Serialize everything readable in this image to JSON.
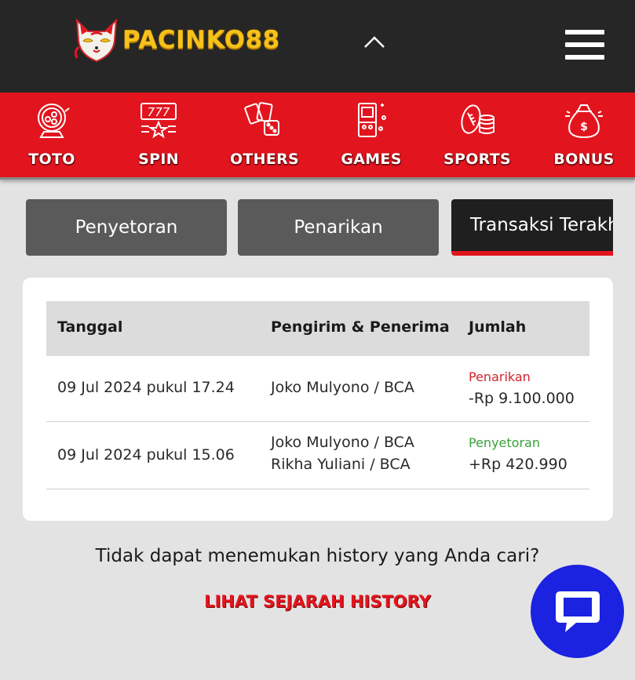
{
  "header": {
    "logo_text": "PACINKO88",
    "collapse_icon": "chevron-up-icon",
    "menu_icon": "hamburger-menu-icon"
  },
  "categories": [
    {
      "label": "TOTO",
      "icon": "lottery-drum-icon"
    },
    {
      "label": "SPIN",
      "icon": "slot-777-icon"
    },
    {
      "label": "OTHERS",
      "icon": "cards-dice-icon"
    },
    {
      "label": "GAMES",
      "icon": "arcade-machine-icon"
    },
    {
      "label": "SPORTS",
      "icon": "football-coins-icon"
    },
    {
      "label": "BONUS",
      "icon": "money-bag-icon"
    }
  ],
  "tabs": [
    {
      "label": "Penyetoran",
      "active": false
    },
    {
      "label": "Penarikan",
      "active": false
    },
    {
      "label": "Transaksi Terakhir",
      "active": true
    }
  ],
  "table": {
    "headers": [
      "Tanggal",
      "Pengirim & Penerima",
      "Jumlah"
    ],
    "rows": [
      {
        "date": "09 Jul 2024 pukul 17.24",
        "party_1": "Joko Mulyono / BCA",
        "party_2": "",
        "type": "Penarikan",
        "amount": "-Rp 9.100.000"
      },
      {
        "date": "09 Jul 2024 pukul 15.06",
        "party_1": "Joko Mulyono / BCA",
        "party_2": "Rikha Yuliani / BCA",
        "type": "Penyetoran",
        "amount": "+Rp 420.990"
      }
    ]
  },
  "footer": {
    "not_found_text": "Tidak dapat menemukan history yang Anda cari?",
    "history_link": "LIHAT SEJARAH HISTORY"
  },
  "chat": {
    "icon": "chat-bubble-icon"
  },
  "colors": {
    "header_bg": "#262626",
    "nav_red": "#e2151f",
    "tab_gray": "#5a5a5a",
    "tab_active": "#1f1f1f",
    "withdraw_red": "#d0242a",
    "deposit_green": "#3aa13a",
    "chat_blue": "#1b22e0",
    "logo_gold": "#f6c21a"
  }
}
